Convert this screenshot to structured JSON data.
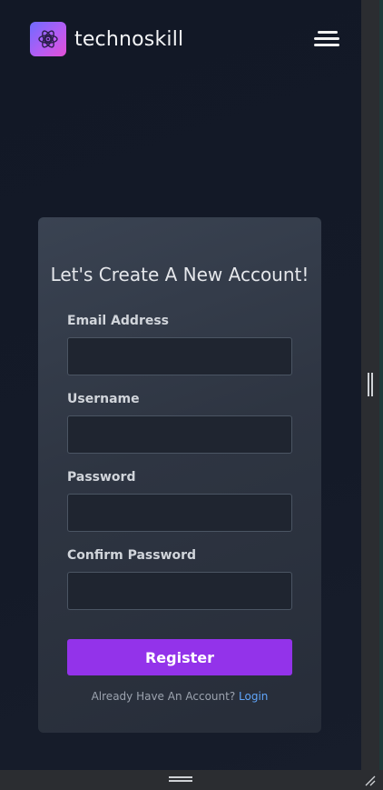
{
  "header": {
    "brand_name": "technoskill",
    "logo_icon": "atom-logo-icon",
    "menu_icon": "hamburger-menu-icon"
  },
  "form": {
    "title": "Let's Create A New Account!",
    "fields": [
      {
        "label": "Email Address",
        "value": "",
        "placeholder": ""
      },
      {
        "label": "Username",
        "value": "",
        "placeholder": ""
      },
      {
        "label": "Password",
        "value": "",
        "placeholder": ""
      },
      {
        "label": "Confirm Password",
        "value": "",
        "placeholder": ""
      }
    ],
    "submit_label": "Register",
    "footer_text": "Already Have An Account?",
    "login_link": "Login"
  },
  "colors": {
    "accent": "#9333ea",
    "link": "#60a5fa",
    "background": "#121826",
    "card": "#2e3542"
  }
}
